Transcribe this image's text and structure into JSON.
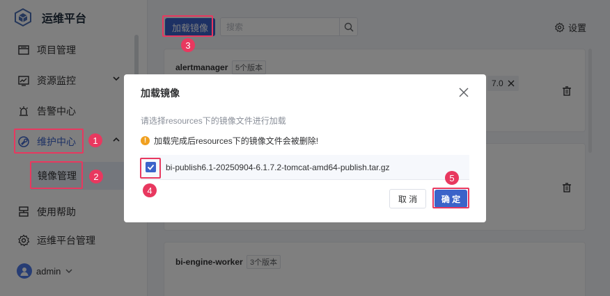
{
  "sidebar": {
    "brand": "运维平台",
    "items": [
      {
        "label": "项目管理",
        "icon": "project-icon"
      },
      {
        "label": "资源监控",
        "icon": "monitor-chart-icon"
      },
      {
        "label": "告警中心",
        "icon": "alarm-icon"
      },
      {
        "label": "维护中心",
        "icon": "maintenance-icon"
      },
      {
        "label": "使用帮助",
        "icon": "help-icon"
      },
      {
        "label": "运维平台管理",
        "icon": "gear-icon"
      }
    ],
    "sub_item": "镜像管理",
    "user": "admin"
  },
  "toolbar": {
    "load_button": "加载镜像",
    "search_placeholder": "搜索",
    "settings_label": "设置"
  },
  "cards": [
    {
      "name": "alertmanager",
      "badge": "5个版本",
      "tag_suffix": "7.0"
    },
    {
      "name": "bi-engine-worker",
      "badge": "3个版本"
    }
  ],
  "modal": {
    "title": "加载镜像",
    "description": "请选择resources下的镜像文件进行加载",
    "warning": "加载完成后resources下的镜像文件会被删除!",
    "file_name": "bi-publish6.1-20250904-6.1.7.2-tomcat-amd64-publish.tar.gz",
    "file_checked": true,
    "cancel": "取 消",
    "confirm": "确 定"
  },
  "steps": [
    "1",
    "2",
    "3",
    "4",
    "5"
  ],
  "colors": {
    "primary": "#3b63c9",
    "annotation": "#e8385f",
    "warning": "#f0a020"
  }
}
